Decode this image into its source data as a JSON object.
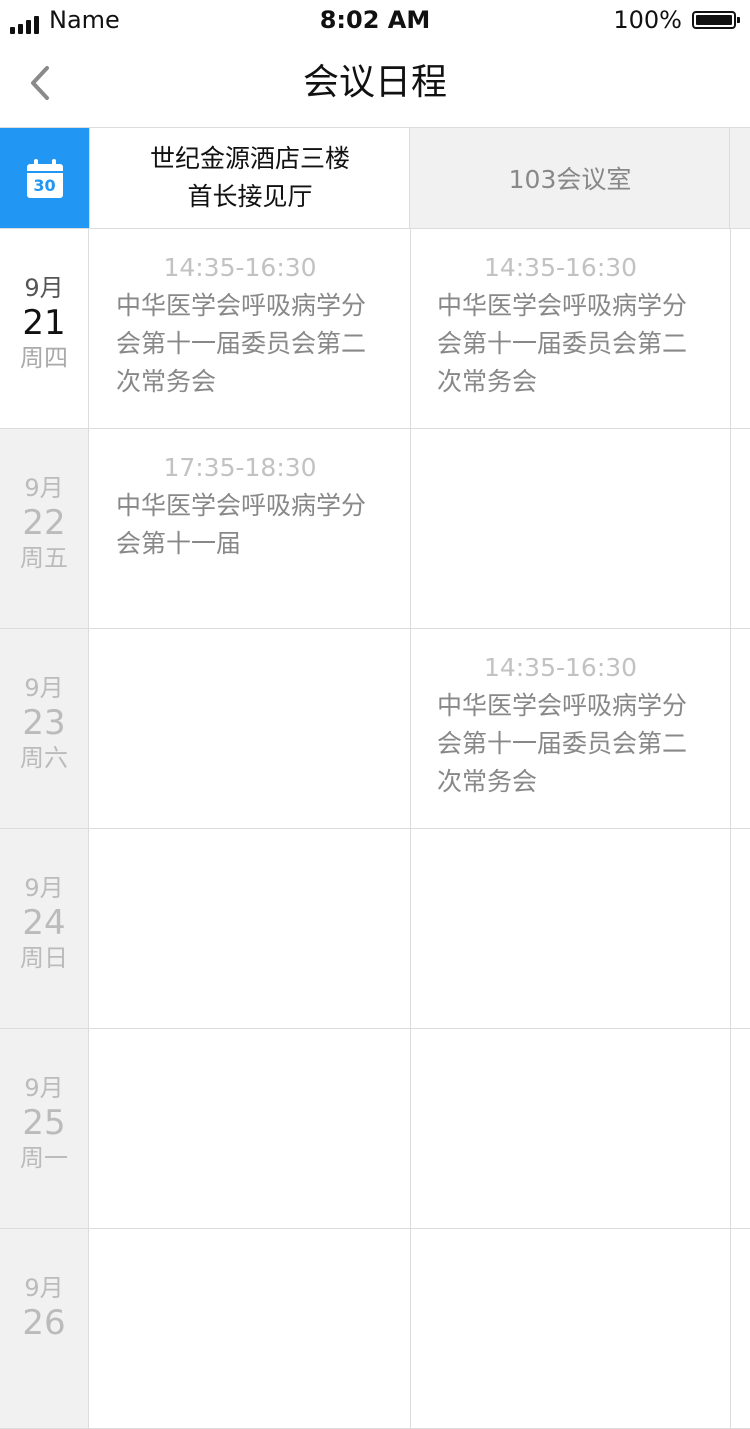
{
  "status_bar": {
    "carrier": "Name",
    "time": "8:02 AM",
    "battery_percent": "100%",
    "battery_level": 1.0
  },
  "nav": {
    "title": "会议日程",
    "back_icon": "chevron-left-icon"
  },
  "calendar_icon": {
    "icon": "calendar-icon",
    "day": "30",
    "color": "#2196f3"
  },
  "rooms": [
    {
      "line1": "世纪金源酒店三楼",
      "line2": "首长接见厅"
    },
    {
      "line1": "103会议室",
      "line2": ""
    }
  ],
  "days": [
    {
      "month": "9月",
      "day": "21",
      "weekday": "周四",
      "selected": true,
      "events": [
        {
          "time": "14:35-16:30",
          "title": "中华医学会呼吸病学分会第十一届委员会第二次常务会"
        },
        {
          "time": "14:35-16:30",
          "title": "中华医学会呼吸病学分会第十一届委员会第二次常务会"
        }
      ]
    },
    {
      "month": "9月",
      "day": "22",
      "weekday": "周五",
      "selected": false,
      "events": [
        {
          "time": "17:35-18:30",
          "title": "中华医学会呼吸病学分会第十一届"
        },
        {
          "time": "",
          "title": ""
        }
      ]
    },
    {
      "month": "9月",
      "day": "23",
      "weekday": "周六",
      "selected": false,
      "events": [
        {
          "time": "",
          "title": ""
        },
        {
          "time": "14:35-16:30",
          "title": "中华医学会呼吸病学分会第十一届委员会第二次常务会"
        }
      ]
    },
    {
      "month": "9月",
      "day": "24",
      "weekday": "周日",
      "selected": false,
      "events": [
        {
          "time": "",
          "title": ""
        },
        {
          "time": "",
          "title": ""
        }
      ]
    },
    {
      "month": "9月",
      "day": "25",
      "weekday": "周一",
      "selected": false,
      "events": [
        {
          "time": "",
          "title": ""
        },
        {
          "time": "",
          "title": ""
        }
      ]
    },
    {
      "month": "9月",
      "day": "26",
      "weekday": "",
      "selected": false,
      "events": [
        {
          "time": "",
          "title": ""
        },
        {
          "time": "",
          "title": ""
        }
      ]
    }
  ]
}
